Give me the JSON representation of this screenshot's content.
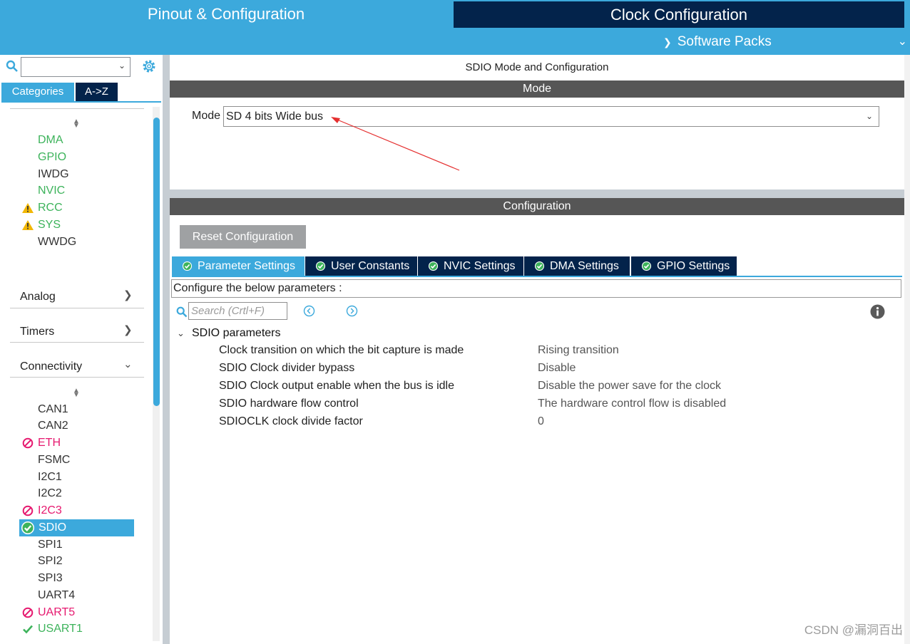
{
  "top_tabs": {
    "pinout": "Pinout & Configuration",
    "clock": "Clock Configuration"
  },
  "software_packs": "Software Packs",
  "sidebar": {
    "tabs": {
      "categories": "Categories",
      "az": "A->Z"
    },
    "system_items": [
      {
        "label": "DMA",
        "status": "ok"
      },
      {
        "label": "GPIO",
        "status": "ok"
      },
      {
        "label": "IWDG",
        "status": "none"
      },
      {
        "label": "NVIC",
        "status": "ok"
      },
      {
        "label": "RCC",
        "status": "warning"
      },
      {
        "label": "SYS",
        "status": "warning"
      },
      {
        "label": "WWDG",
        "status": "none"
      }
    ],
    "groups": {
      "analog": "Analog",
      "timers": "Timers",
      "connectivity": "Connectivity"
    },
    "connectivity_items": [
      {
        "label": "CAN1",
        "status": "none"
      },
      {
        "label": "CAN2",
        "status": "none"
      },
      {
        "label": "ETH",
        "status": "unavailable"
      },
      {
        "label": "FSMC",
        "status": "none"
      },
      {
        "label": "I2C1",
        "status": "none"
      },
      {
        "label": "I2C2",
        "status": "none"
      },
      {
        "label": "I2C3",
        "status": "unavailable"
      },
      {
        "label": "SDIO",
        "status": "selected"
      },
      {
        "label": "SPI1",
        "status": "none"
      },
      {
        "label": "SPI2",
        "status": "none"
      },
      {
        "label": "SPI3",
        "status": "none"
      },
      {
        "label": "UART4",
        "status": "none"
      },
      {
        "label": "UART5",
        "status": "unavailable"
      },
      {
        "label": "USART1",
        "status": "ok"
      }
    ]
  },
  "main": {
    "title": "SDIO Mode and Configuration",
    "mode_header": "Mode",
    "mode_label": "Mode",
    "mode_value": "SD 4 bits Wide bus",
    "config_header": "Configuration",
    "reset_button": "Reset Configuration",
    "tabs": [
      "Parameter Settings",
      "User Constants",
      "NVIC Settings",
      "DMA Settings",
      "GPIO Settings"
    ],
    "configure_text": "Configure the below parameters :",
    "search_placeholder": "Search (Crtl+F)",
    "params_group": "SDIO parameters",
    "params": [
      {
        "name": "Clock transition on which the bit capture is made",
        "value": "Rising transition"
      },
      {
        "name": "SDIO Clock divider bypass",
        "value": "Disable"
      },
      {
        "name": "SDIO Clock output enable when the bus is idle",
        "value": "Disable the power save for the clock"
      },
      {
        "name": "SDIO hardware flow control",
        "value": "The hardware control flow is disabled"
      },
      {
        "name": "SDIOCLK clock divide factor",
        "value": "0"
      }
    ]
  },
  "watermark": "CSDN @漏洞百出",
  "colors": {
    "accent": "#3ca9dc",
    "dark_navy": "#03234b",
    "header_gray": "#565656",
    "ok_green": "#3db35b",
    "error_pink": "#e6196f",
    "warning_yellow": "#f2b705"
  }
}
